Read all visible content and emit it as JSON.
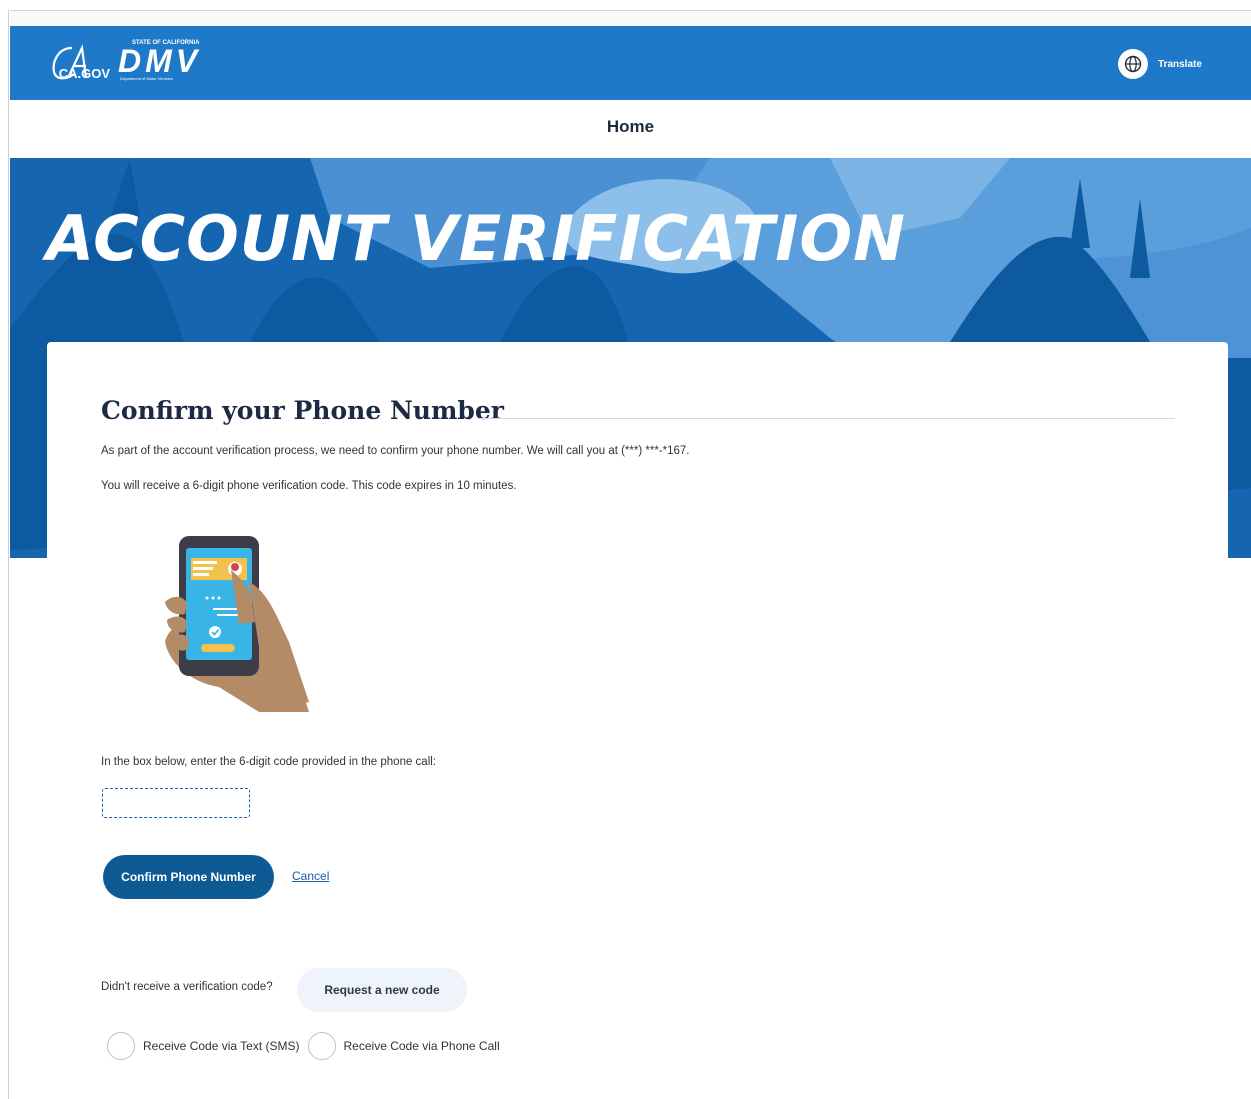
{
  "header": {
    "ca_logo": "CA.GOV",
    "dmv_logo": {
      "top_text": "STATE OF CALIFORNIA",
      "main_text": "DMV",
      "sub_text": "Department of Motor Vehicles"
    },
    "translate_label": "Translate"
  },
  "nav": {
    "home_label": "Home"
  },
  "hero": {
    "title": "ACCOUNT VERIFICATION"
  },
  "card": {
    "title": "Confirm your Phone Number",
    "paragraph_1": "As part of the account verification process, we need to confirm your phone number. We will call you at (***) ***-*167.",
    "paragraph_2": "You will receive a 6-digit phone verification code. This code expires in 10 minutes.",
    "code_prompt": "In the box below, enter the 6-digit code provided in the phone call:",
    "code_value": "",
    "confirm_label": "Confirm Phone Number",
    "cancel_label": "Cancel",
    "resend_prompt": "Didn't receive a verification code?",
    "resend_label": "Request a new code",
    "options": [
      "Receive Code via Text (SMS)",
      "Receive Code via Phone Call"
    ]
  },
  "colors": {
    "header_blue": "#1e7ac8",
    "hero_light": "#5a9fdb",
    "hero_dark": "#0d5aa0",
    "button_navy": "#0e5a95",
    "link_blue": "#1d5fa0"
  }
}
